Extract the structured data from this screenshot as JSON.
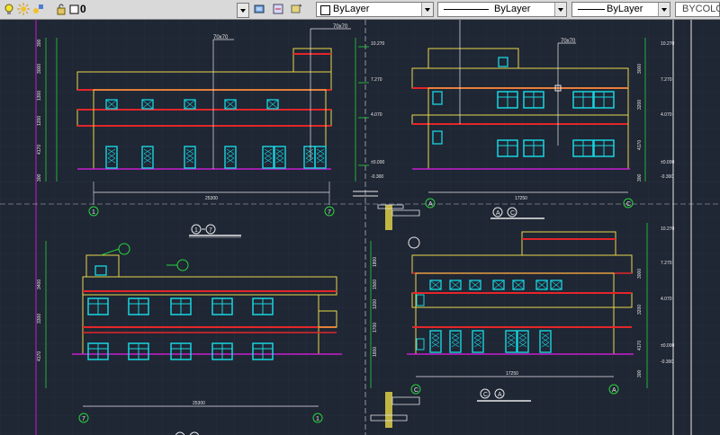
{
  "toolbar": {
    "layer_value": "0",
    "color_value": "ByLayer",
    "linetype_value": "ByLayer",
    "lineweight_value": "ByLayer",
    "plotstyle_value": "BYCOLOR",
    "icons": [
      "lightbulb-icon",
      "sun-icon",
      "layer-lock-icon",
      "layer-color-icon",
      "make-current-icon",
      "layer-previous-icon",
      "layer-match-icon"
    ]
  },
  "colors": {
    "background": "#1f2634",
    "grid_line": "#2b3345",
    "outline": "#e8d84a",
    "red": "#e3262a",
    "cyan": "#18d6e0",
    "white": "#e8e8e8",
    "green": "#29d43d",
    "magenta": "#c51fcf"
  },
  "drawing": {
    "elevation_1": {
      "overall_dim": "25300",
      "axis_left": "1",
      "axis_right": "7",
      "title_axes": [
        "1",
        "7"
      ],
      "top_tag": "70x70",
      "top_tag2": "70x70",
      "left_dims": [
        "300",
        "3000",
        "1300",
        "1200",
        "4170",
        "300"
      ],
      "right_levels": [
        "10.270",
        "7.270",
        "4.070",
        "±0.000",
        "-0.300"
      ]
    },
    "elevation_2": {
      "overall_dim": "17250",
      "axis_left": "A",
      "axis_right": "C",
      "title_axes": [
        "A",
        "C"
      ],
      "top_tag": "70x70",
      "right_dims": [
        "3000",
        "3200",
        "4170",
        "300"
      ],
      "right_levels": [
        "10.270",
        "7.270",
        "4.070",
        "±0.000",
        "-0.300"
      ]
    },
    "elevation_3": {
      "overall_dim": "25300",
      "axis_left": "7",
      "axis_right": "1",
      "title_axes": [
        "7",
        "1"
      ],
      "left_dims": [
        "3400",
        "3300",
        "4170"
      ]
    },
    "elevation_4": {
      "overall_dim": "17250",
      "axis_left": "C",
      "axis_right": "A",
      "title_axes": [
        "C",
        "A"
      ],
      "left_dims": [
        "1800",
        "1500",
        "1200",
        "1700",
        "1600"
      ],
      "right_dims": [
        "3000",
        "3200",
        "4170",
        "300"
      ],
      "right_levels": [
        "10.270",
        "7.270",
        "4.070",
        "±0.000",
        "-0.300"
      ]
    }
  }
}
